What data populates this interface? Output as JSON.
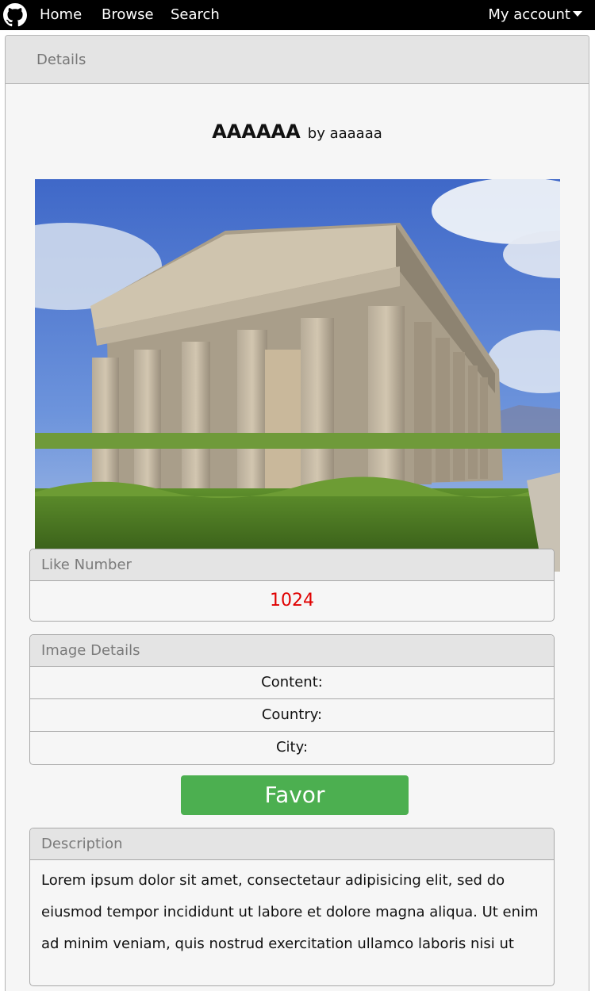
{
  "nav": {
    "home": "Home",
    "browse": "Browse",
    "search": "Search",
    "account": "My account",
    "logo_icon": "github-icon",
    "account_icon": "caret-down-icon"
  },
  "panel": {
    "header": "Details"
  },
  "artwork": {
    "title": "AAAAAA",
    "by": "by aaaaaa",
    "image_alt": "Greek temple with columns under a blue sky"
  },
  "like": {
    "header": "Like Number",
    "value": "1024",
    "value_color": "#e00000"
  },
  "image_details": {
    "header": "Image Details",
    "rows": [
      "Content:",
      "Country:",
      "City:"
    ]
  },
  "favor": {
    "label": "Favor",
    "color": "#4caf50"
  },
  "description": {
    "header": "Description",
    "text": "Lorem ipsum dolor sit amet, consectetaur adipisicing elit, sed do eiusmod tempor incididunt ut labore et dolore magna aliqua. Ut enim ad minim veniam, quis nostrud exercitation ullamco laboris nisi ut"
  }
}
